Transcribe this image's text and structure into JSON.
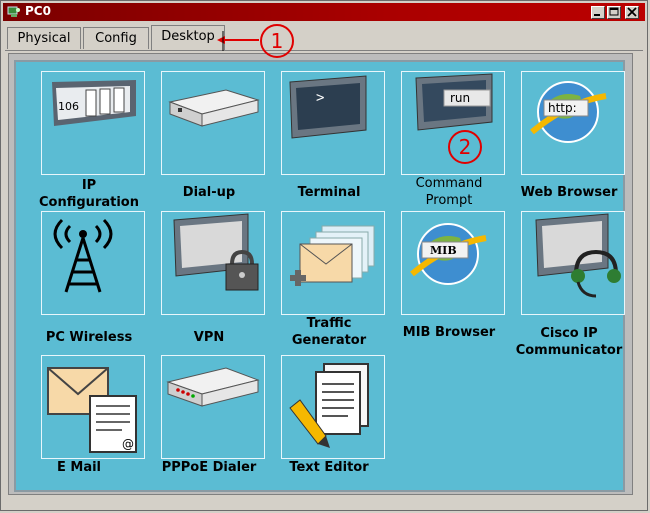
{
  "window": {
    "title": "PC0"
  },
  "tabs": [
    {
      "label": "Physical"
    },
    {
      "label": "Config"
    },
    {
      "label": "Desktop"
    }
  ],
  "apps": [
    {
      "name": "ip-configuration",
      "label": "IP\nConfiguration"
    },
    {
      "name": "dial-up",
      "label": "Dial-up"
    },
    {
      "name": "terminal",
      "label": "Terminal"
    },
    {
      "name": "command-prompt",
      "label": "Command\nPrompt"
    },
    {
      "name": "web-browser",
      "label": "Web Browser"
    },
    {
      "name": "pc-wireless",
      "label": "PC Wireless"
    },
    {
      "name": "vpn",
      "label": "VPN"
    },
    {
      "name": "traffic-generator",
      "label": "Traffic\nGenerator"
    },
    {
      "name": "mib-browser",
      "label": "MIB Browser"
    },
    {
      "name": "cisco-ip-communicator",
      "label": "Cisco IP\nCommunicator"
    },
    {
      "name": "e-mail",
      "label": "E Mail"
    },
    {
      "name": "pppoe-dialer",
      "label": "PPPoE Dialer"
    },
    {
      "name": "text-editor",
      "label": "Text Editor"
    }
  ],
  "icon_text": {
    "ip_number": "106",
    "cmd_run": "run",
    "http": "http:",
    "mib": "MIB"
  },
  "annotations": [
    {
      "number": "1"
    },
    {
      "number": "2"
    }
  ],
  "colors": {
    "titlebar": "#a00000",
    "desktop_bg": "#5bbcd3",
    "annotation": "#e00000"
  }
}
